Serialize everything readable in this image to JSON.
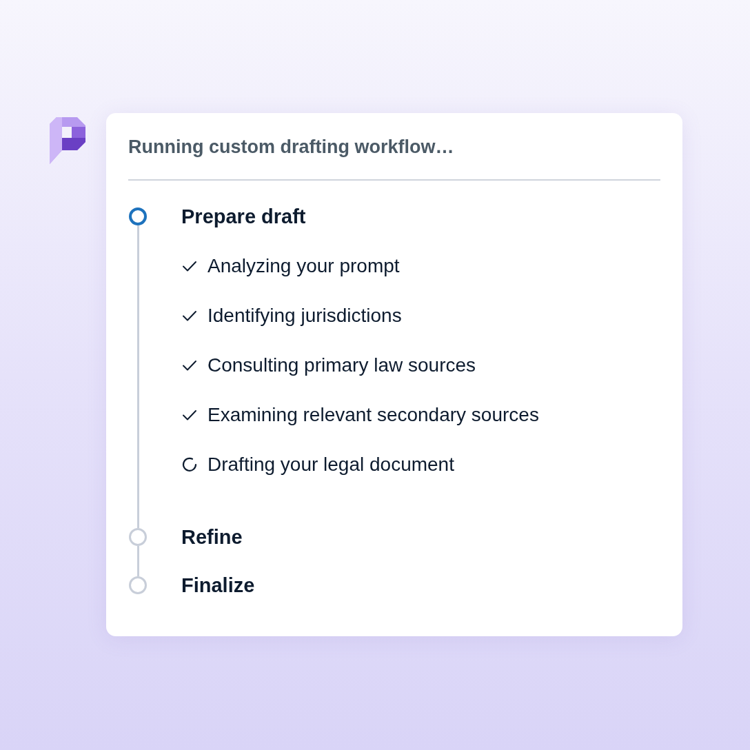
{
  "title": "Running custom drafting workflow…",
  "stages": [
    {
      "title": "Prepare draft",
      "active": true,
      "steps": [
        {
          "text": "Analyzing your prompt",
          "done": true
        },
        {
          "text": "Identifying jurisdictions",
          "done": true
        },
        {
          "text": "Consulting primary law sources",
          "done": true
        },
        {
          "text": "Examining relevant secondary sources",
          "done": true
        },
        {
          "text": "Drafting your legal document",
          "done": false
        }
      ]
    },
    {
      "title": "Refine",
      "active": false
    },
    {
      "title": "Finalize",
      "active": false
    }
  ]
}
